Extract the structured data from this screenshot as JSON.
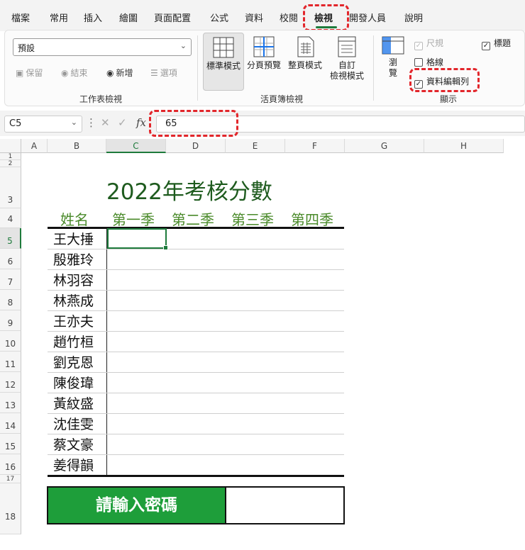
{
  "ribbon_tabs": [
    "檔案",
    "常用",
    "插入",
    "繪圖",
    "頁面配置",
    "公式",
    "資料",
    "校閱",
    "檢視",
    "開發人員",
    "說明"
  ],
  "sheet_view": {
    "dropdown_value": "預設",
    "keep_label": "保留",
    "exit_label": "結束",
    "new_label": "新增",
    "options_label": "選項",
    "group_label": "工作表檢視"
  },
  "workbook_views": {
    "normal": "標準模式",
    "page_break_preview": "分頁預覽",
    "page_layout": "整頁模式",
    "custom_views_1": "自訂",
    "custom_views_2": "檢視模式",
    "group_label": "活頁簿檢視"
  },
  "show_group": {
    "navigation": "瀏覽",
    "ruler": "尺規",
    "gridlines": "格線",
    "formula_bar": "資料編輯列",
    "headings": "標題",
    "group_label": "顯示"
  },
  "formula_bar": {
    "name_box": "C5",
    "value": "65"
  },
  "columns": [
    "A",
    "B",
    "C",
    "D",
    "E",
    "F",
    "G",
    "H"
  ],
  "rows": [
    "1",
    "2",
    "3",
    "4",
    "5",
    "6",
    "7",
    "8",
    "9",
    "10",
    "11",
    "12",
    "13",
    "14",
    "15",
    "16",
    "17",
    "18"
  ],
  "sheet": {
    "title": "2022年考核分數",
    "header": [
      "姓名",
      "第一季",
      "第二季",
      "第三季",
      "第四季"
    ],
    "names": [
      "王大捶",
      "殷雅玲",
      "林羽容",
      "林燕成",
      "王亦夫",
      "趙竹桓",
      "劉克恩",
      "陳俊瑋",
      "黃紋盛",
      "沈佳雯",
      "蔡文豪",
      "姜得韻"
    ],
    "password_label": "請輸入密碼"
  },
  "colors": {
    "accent": "#1e7b3c",
    "highlight": "#e2262b",
    "password_bg": "#1e9e3a"
  }
}
